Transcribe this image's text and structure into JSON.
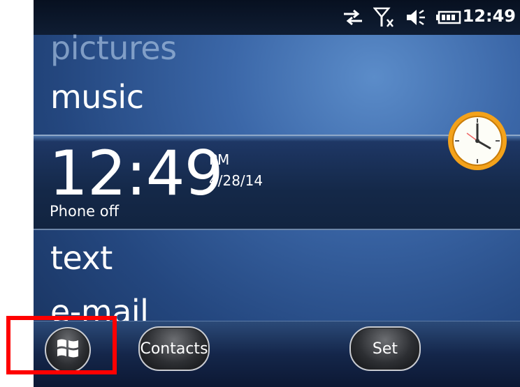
{
  "status_bar": {
    "icons": [
      "data-sync-icon",
      "no-signal-icon",
      "speaker-muted-icon",
      "battery-icon"
    ],
    "time": "12:49"
  },
  "menu": {
    "items": [
      "pictures",
      "music",
      "text",
      "e-mail"
    ]
  },
  "clock_panel": {
    "time": "12:49",
    "ampm": "PM",
    "date": "4/28/14",
    "phone_status": "Phone off"
  },
  "softkeys": {
    "left": "Contacts",
    "right": "Set"
  },
  "colors": {
    "highlight": "#ff0000"
  }
}
